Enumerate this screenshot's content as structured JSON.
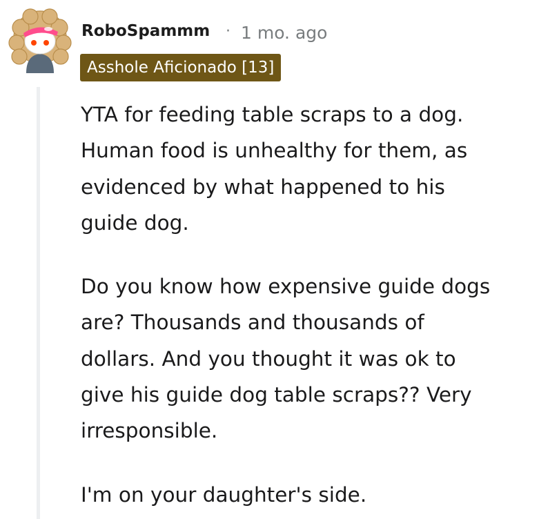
{
  "comment": {
    "author": "RoboSpammm",
    "separator": "·",
    "timestamp": "1 mo. ago",
    "flair": "Asshole Aficionado [13]",
    "paragraphs": [
      "YTA for feeding table scraps to a dog.\nHuman food is unhealthy for them, as\nevidenced by what happened to his\nguide dog.",
      "Do you know how expensive guide dogs\nare? Thousands and thousands of\ndollars. And you thought it was ok to\ngive his guide dog table scraps?? Very\nirresponsible.",
      "I'm on your daughter's side."
    ]
  },
  "colors": {
    "flair_background": "#6e5616",
    "flair_text": "#ffffff",
    "timestamp": "#787c7e",
    "thread_line": "#edeff1",
    "body_text": "#1a1a1b"
  },
  "icons": {
    "avatar": "snoo-avatar-icon"
  }
}
